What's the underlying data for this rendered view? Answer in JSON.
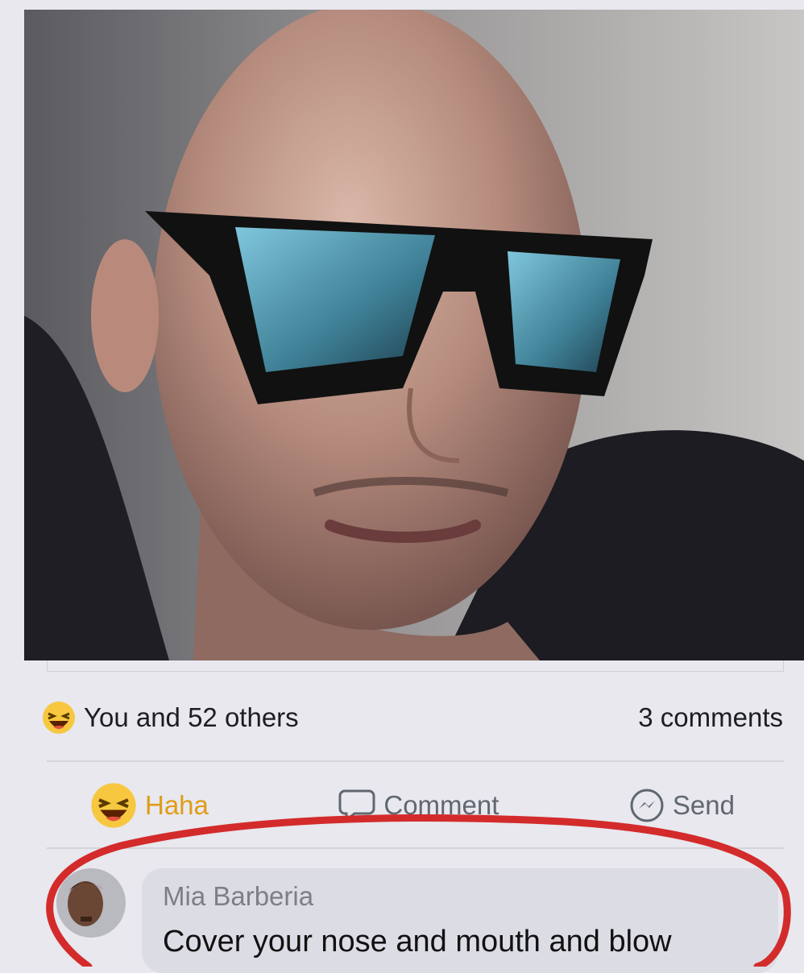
{
  "post": {
    "reactions_summary": "You and 52 others",
    "comments_count": "3 comments",
    "reaction_icon": "haha-emoji-icon"
  },
  "actions": {
    "haha_label": "Haha",
    "comment_label": "Comment",
    "send_label": "Send"
  },
  "comment": {
    "author": "Mia Barberia",
    "text": "Cover your nose and mouth and blow"
  },
  "colors": {
    "haha": "#e09c16",
    "annotation": "#d32b2b",
    "muted_text": "#606770"
  }
}
